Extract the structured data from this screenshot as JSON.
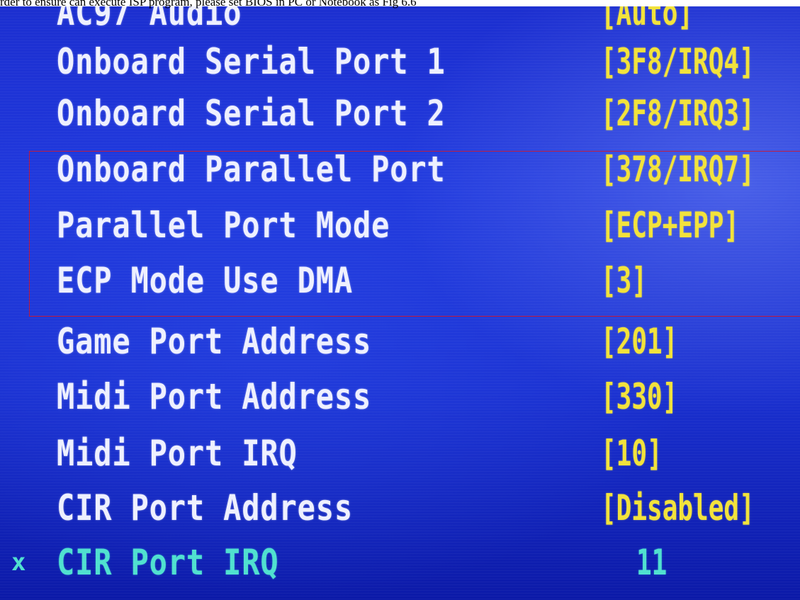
{
  "caption": "rder to ensure can execute ISP program, please set BIOS in PC or Notebook as Fig 6.6",
  "colors": {
    "background": "#1c2fd0",
    "label": "#eef0ff",
    "value": "#f2e23a",
    "disabled": "#4fe0cf",
    "highlight_box": "#c0163a"
  },
  "bios_settings": [
    {
      "label": "AC97 Audio",
      "value": "[Auto]"
    },
    {
      "label": "Onboard Serial Port 1",
      "value": "[3F8/IRQ4]"
    },
    {
      "label": "Onboard Serial Port 2",
      "value": "[2F8/IRQ3]"
    },
    {
      "label": "Onboard Parallel Port",
      "value": "[378/IRQ7]"
    },
    {
      "label": "Parallel Port Mode",
      "value": "[ECP+EPP]"
    },
    {
      "label": "ECP Mode Use DMA",
      "value": "[3]"
    },
    {
      "label": "Game Port Address",
      "value": "[201]"
    },
    {
      "label": "Midi Port Address",
      "value": "[330]"
    },
    {
      "label": "Midi Port IRQ",
      "value": "[10]"
    },
    {
      "label": "CIR Port Address",
      "value": "[Disabled]"
    },
    {
      "label": "CIR Port IRQ",
      "value": "11",
      "mark": "x"
    }
  ]
}
